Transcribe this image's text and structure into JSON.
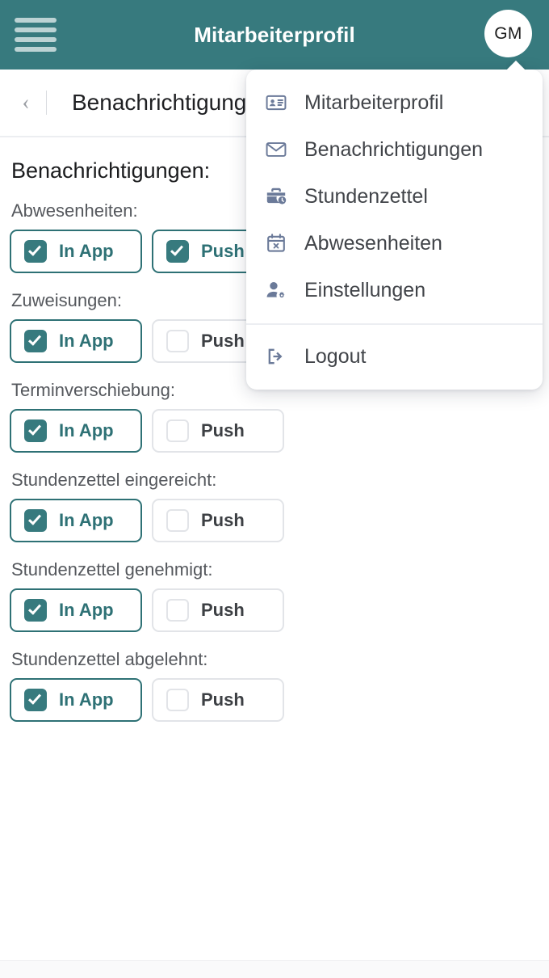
{
  "appbar": {
    "title": "Mitarbeiterprofil",
    "menu_icon": "hamburger-icon",
    "avatar_initials": "GM"
  },
  "breadcrumb": {
    "back_icon": "chevron-left-icon",
    "title": "Benachrichtigungen"
  },
  "page": {
    "section_title": "Benachrichtigungen:"
  },
  "groups": [
    {
      "label": "Abwesenheiten:",
      "in_app": {
        "label": "In App",
        "checked": true
      },
      "push": {
        "label": "Push",
        "checked": true
      }
    },
    {
      "label": "Zuweisungen:",
      "in_app": {
        "label": "In App",
        "checked": true
      },
      "push": {
        "label": "Push",
        "checked": false
      }
    },
    {
      "label": "Terminverschiebung:",
      "in_app": {
        "label": "In App",
        "checked": true
      },
      "push": {
        "label": "Push",
        "checked": false
      }
    },
    {
      "label": "Stundenzettel eingereicht:",
      "in_app": {
        "label": "In App",
        "checked": true
      },
      "push": {
        "label": "Push",
        "checked": false
      }
    },
    {
      "label": "Stundenzettel genehmigt:",
      "in_app": {
        "label": "In App",
        "checked": true
      },
      "push": {
        "label": "Push",
        "checked": false
      }
    },
    {
      "label": "Stundenzettel abgelehnt:",
      "in_app": {
        "label": "In App",
        "checked": true
      },
      "push": {
        "label": "Push",
        "checked": false
      }
    }
  ],
  "dropdown": {
    "open": true,
    "items": [
      {
        "label": "Mitarbeiterprofil",
        "icon": "id-card-icon"
      },
      {
        "label": "Benachrichtigungen",
        "icon": "envelope-icon"
      },
      {
        "label": "Stundenzettel",
        "icon": "briefcase-clock-icon"
      },
      {
        "label": "Abwesenheiten",
        "icon": "calendar-x-icon"
      },
      {
        "label": "Einstellungen",
        "icon": "user-gear-icon"
      }
    ],
    "logout": {
      "label": "Logout",
      "icon": "logout-icon"
    }
  },
  "colors": {
    "brand_teal": "#377a7e",
    "brand_teal_dark": "#2e7175",
    "hamburger_bar": "#bcd3d4",
    "menu_icon": "#6b7a99",
    "border_gray": "#e2e4e8"
  }
}
